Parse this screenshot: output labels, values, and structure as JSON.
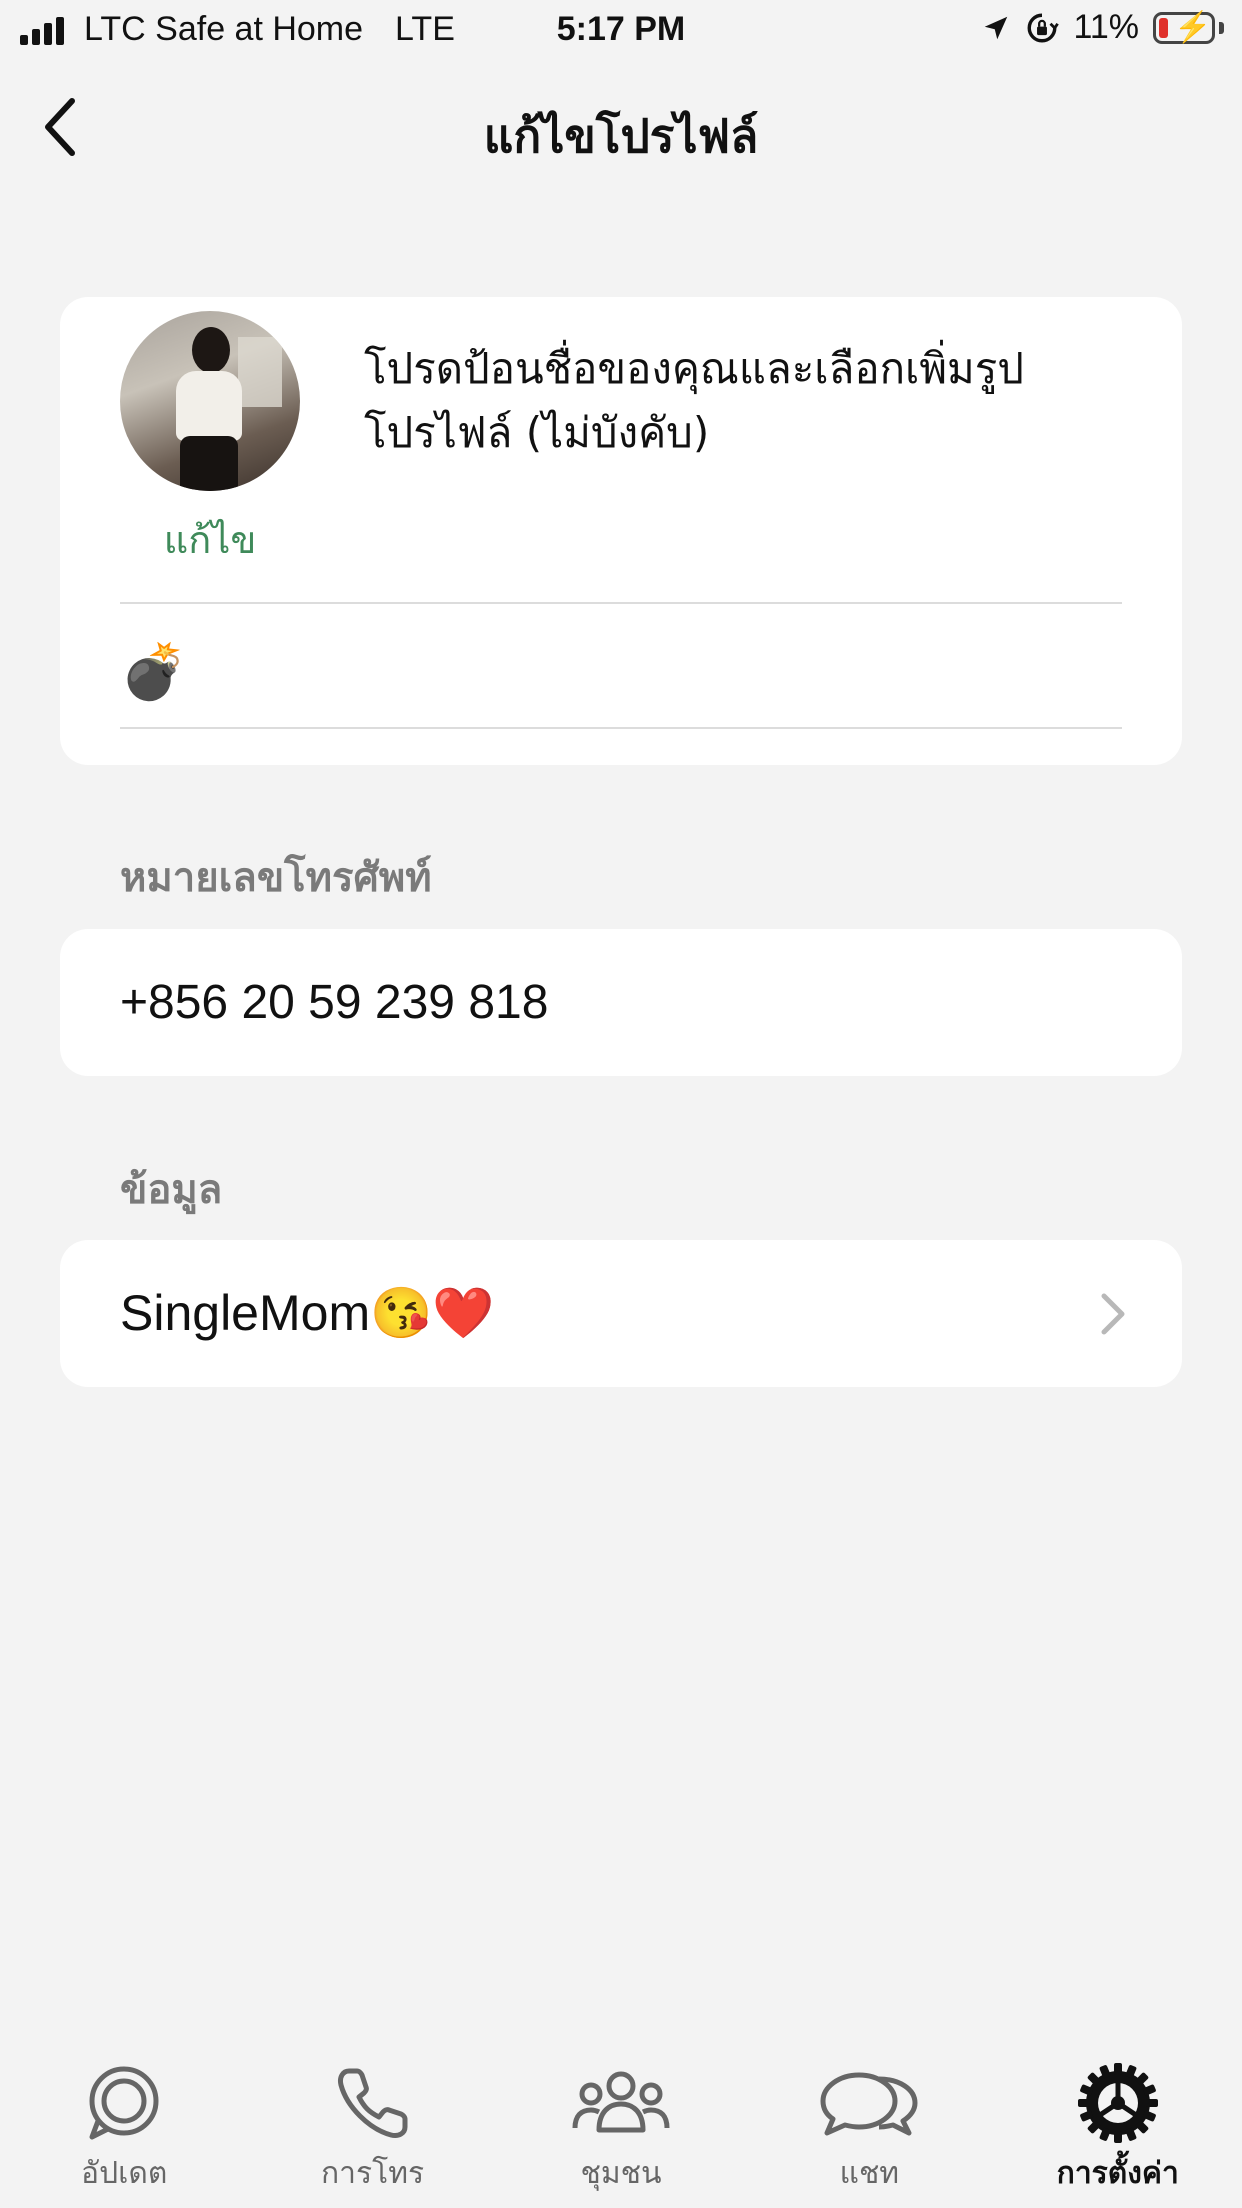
{
  "status_bar": {
    "carrier": "LTC Safe at Home",
    "network": "LTE",
    "time": "5:17 PM",
    "battery": "11%"
  },
  "nav": {
    "title": "แก้ไขโปรไฟล์"
  },
  "profile": {
    "edit_photo_label": "แก้ไข",
    "hint": "โปรดป้อนชื่อของคุณและเลือกเพิ่มรูปโปรไฟล์ (ไม่บังคับ)",
    "name_value": "💣"
  },
  "phone_section": {
    "header": "หมายเลขโทรศัพท์",
    "value": "+856 20 59 239 818"
  },
  "info_section": {
    "header": "ข้อมูล",
    "value": "SingleMom😘❤️"
  },
  "tabs": [
    {
      "label": "อัปเดต",
      "icon": "updates-icon",
      "active": false
    },
    {
      "label": "การโทร",
      "icon": "phone-icon",
      "active": false
    },
    {
      "label": "ชุมชน",
      "icon": "community-icon",
      "active": false
    },
    {
      "label": "แชท",
      "icon": "chat-icon",
      "active": false
    },
    {
      "label": "การตั้งค่า",
      "icon": "settings-icon",
      "active": true
    }
  ],
  "colors": {
    "accent_green": "#3f8a5a",
    "background": "#f3f3f3",
    "card": "#ffffff",
    "section_header": "#7a7a7a"
  }
}
